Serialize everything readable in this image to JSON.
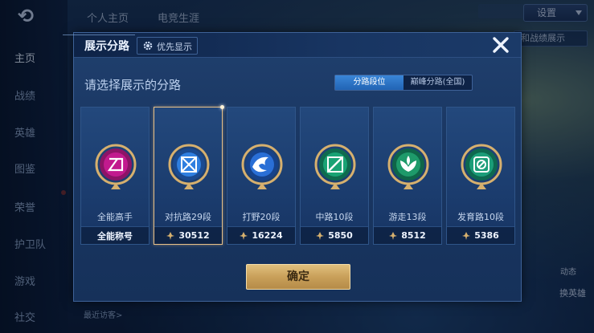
{
  "background": {
    "top_tabs": [
      "个人主页",
      "电竞生涯"
    ],
    "settings_label": "设置",
    "right_chip": "和战绩展示",
    "nav_items": [
      "主页",
      "战绩",
      "英雄",
      "图鉴",
      "荣誉",
      "护卫队",
      "游戏",
      "社交"
    ],
    "bottom_visitors": "最近访客>",
    "bottom_right_label": "换英雄",
    "bottom_right_label2": "动态"
  },
  "modal": {
    "title": "展示分路",
    "priority_label": "优先显示",
    "prompt": "请选择展示的分路",
    "segment": [
      "分路段位",
      "巅峰分路(全国)"
    ],
    "active_segment": 0,
    "confirm_label": "确定",
    "cards": [
      {
        "name": "全能高手",
        "foot": "全能称号",
        "score": "",
        "badge": "all-rounder-badge-icon",
        "color": "#c21a8e",
        "selected": false
      },
      {
        "name": "对抗路29段",
        "foot": "",
        "score": "30512",
        "badge": "clash-lane-badge-icon",
        "color": "#2f7fe0",
        "selected": true
      },
      {
        "name": "打野20段",
        "foot": "",
        "score": "16224",
        "badge": "jungle-badge-icon",
        "color": "#2a6fd6",
        "selected": false
      },
      {
        "name": "中路10段",
        "foot": "",
        "score": "5850",
        "badge": "mid-lane-badge-icon",
        "color": "#19a374",
        "selected": false
      },
      {
        "name": "游走13段",
        "foot": "",
        "score": "8512",
        "badge": "roam-badge-icon",
        "color": "#1e9a6a",
        "selected": false
      },
      {
        "name": "发育路10段",
        "foot": "",
        "score": "5386",
        "badge": "farm-lane-badge-icon",
        "color": "#1b9d78",
        "selected": false
      }
    ]
  },
  "colors": {
    "accent_blue": "#2f7fe0",
    "gold": "#d6b06e",
    "modal_bg": "#1a3763"
  }
}
